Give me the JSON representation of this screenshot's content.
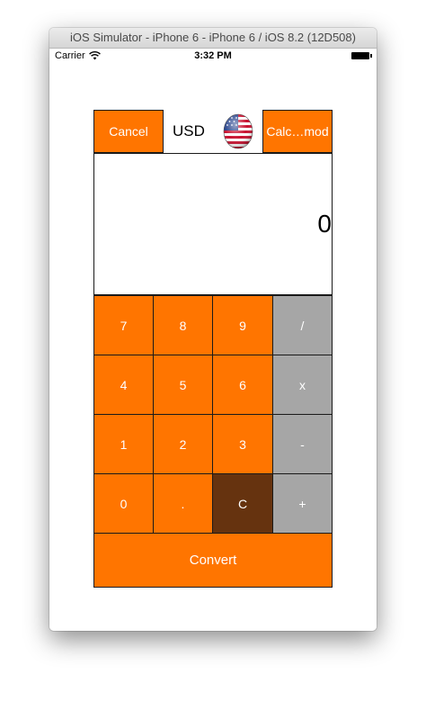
{
  "window": {
    "title": "iOS Simulator - iPhone 6 - iPhone 6 / iOS 8.2 (12D508)"
  },
  "status_bar": {
    "carrier": "Carrier",
    "time": "3:32 PM"
  },
  "header": {
    "cancel_label": "Cancel",
    "currency_code": "USD",
    "flag": "us-flag-icon",
    "calc_mode_label": "Calc…mod"
  },
  "display": {
    "value": "0"
  },
  "keypad": {
    "rows": [
      [
        "7",
        "8",
        "9",
        "/"
      ],
      [
        "4",
        "5",
        "6",
        "x"
      ],
      [
        "1",
        "2",
        "3",
        "-"
      ],
      [
        "0",
        ".",
        "C",
        "+"
      ]
    ]
  },
  "convert_label": "Convert",
  "colors": {
    "orange": "#ff7500",
    "operator_gray": "#a6a6a6",
    "clear_brown": "#66330f"
  }
}
